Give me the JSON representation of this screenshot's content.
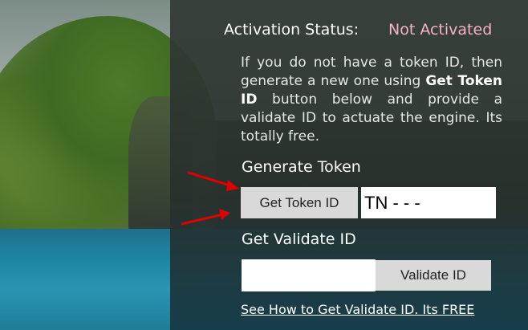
{
  "activation": {
    "status_label": "Activation Status:",
    "status_value": "Not Activated",
    "status_color": "#f3b3c2"
  },
  "info": {
    "text_before": "If you do not have a token ID, then generate a new one using",
    "text_bold": "Get Token ID",
    "text_after": "button below and provide a validate ID to actuate the engine. Its totally free."
  },
  "generate": {
    "title": "Generate Token",
    "button_label": "Get Token ID",
    "token_value": "TN - - -"
  },
  "validate": {
    "title": "Get Validate ID",
    "input_value": "",
    "button_label": "Validate ID"
  },
  "help_link": "See How to Get Validate ID. Its FREE",
  "annotations": {
    "arrow_color": "#e00000",
    "arrow_count": 2
  }
}
